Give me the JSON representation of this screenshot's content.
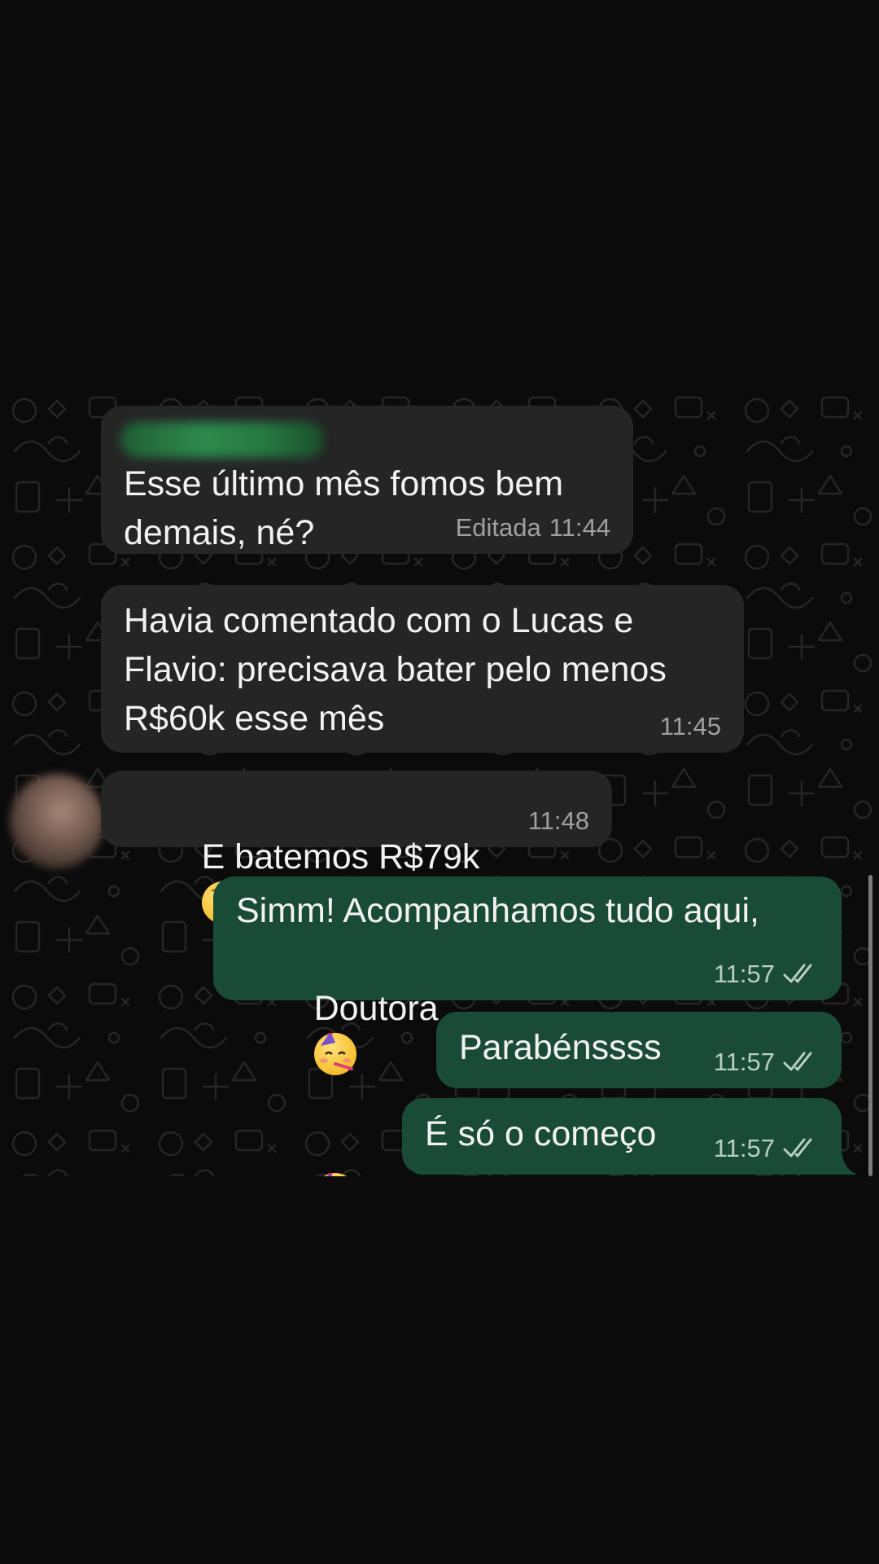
{
  "messages": [
    {
      "direction": "incoming",
      "sender_name_redacted": true,
      "text_line1": "Esse último mês fomos bem",
      "text_line2": "demais, né?",
      "edited_label": "Editada",
      "time": "11:44"
    },
    {
      "direction": "incoming",
      "text_line1": "Havia comentado com o Lucas e",
      "text_line2": "Flavio: precisava bater pelo menos",
      "text_line3": "R$60k esse mês",
      "time": "11:45"
    },
    {
      "direction": "incoming",
      "text": "E batemos R$79k",
      "emoji": "astonished-face-emoji",
      "time": "11:48",
      "avatar_redacted": true
    },
    {
      "direction": "outgoing",
      "text_line1": "Simm! Acompanhamos tudo aqui,",
      "text_line2": "Doutora",
      "emoji": "partying-face-emoji",
      "emoji_count": 2,
      "time": "11:57",
      "status": "read-double-check-icon"
    },
    {
      "direction": "outgoing",
      "text": "Parabénssss",
      "time": "11:57",
      "status": "read-double-check-icon"
    },
    {
      "direction": "outgoing",
      "text": "É só o começo",
      "time": "11:57",
      "status": "read-double-check-icon"
    }
  ],
  "colors": {
    "page_background": "#0c0c0c",
    "chat_background": "#0b0b0b",
    "incoming_bubble": "#252525",
    "outgoing_bubble": "#1a4b37",
    "text": "#f2f2f2",
    "timestamp": "#a0a0a0"
  }
}
